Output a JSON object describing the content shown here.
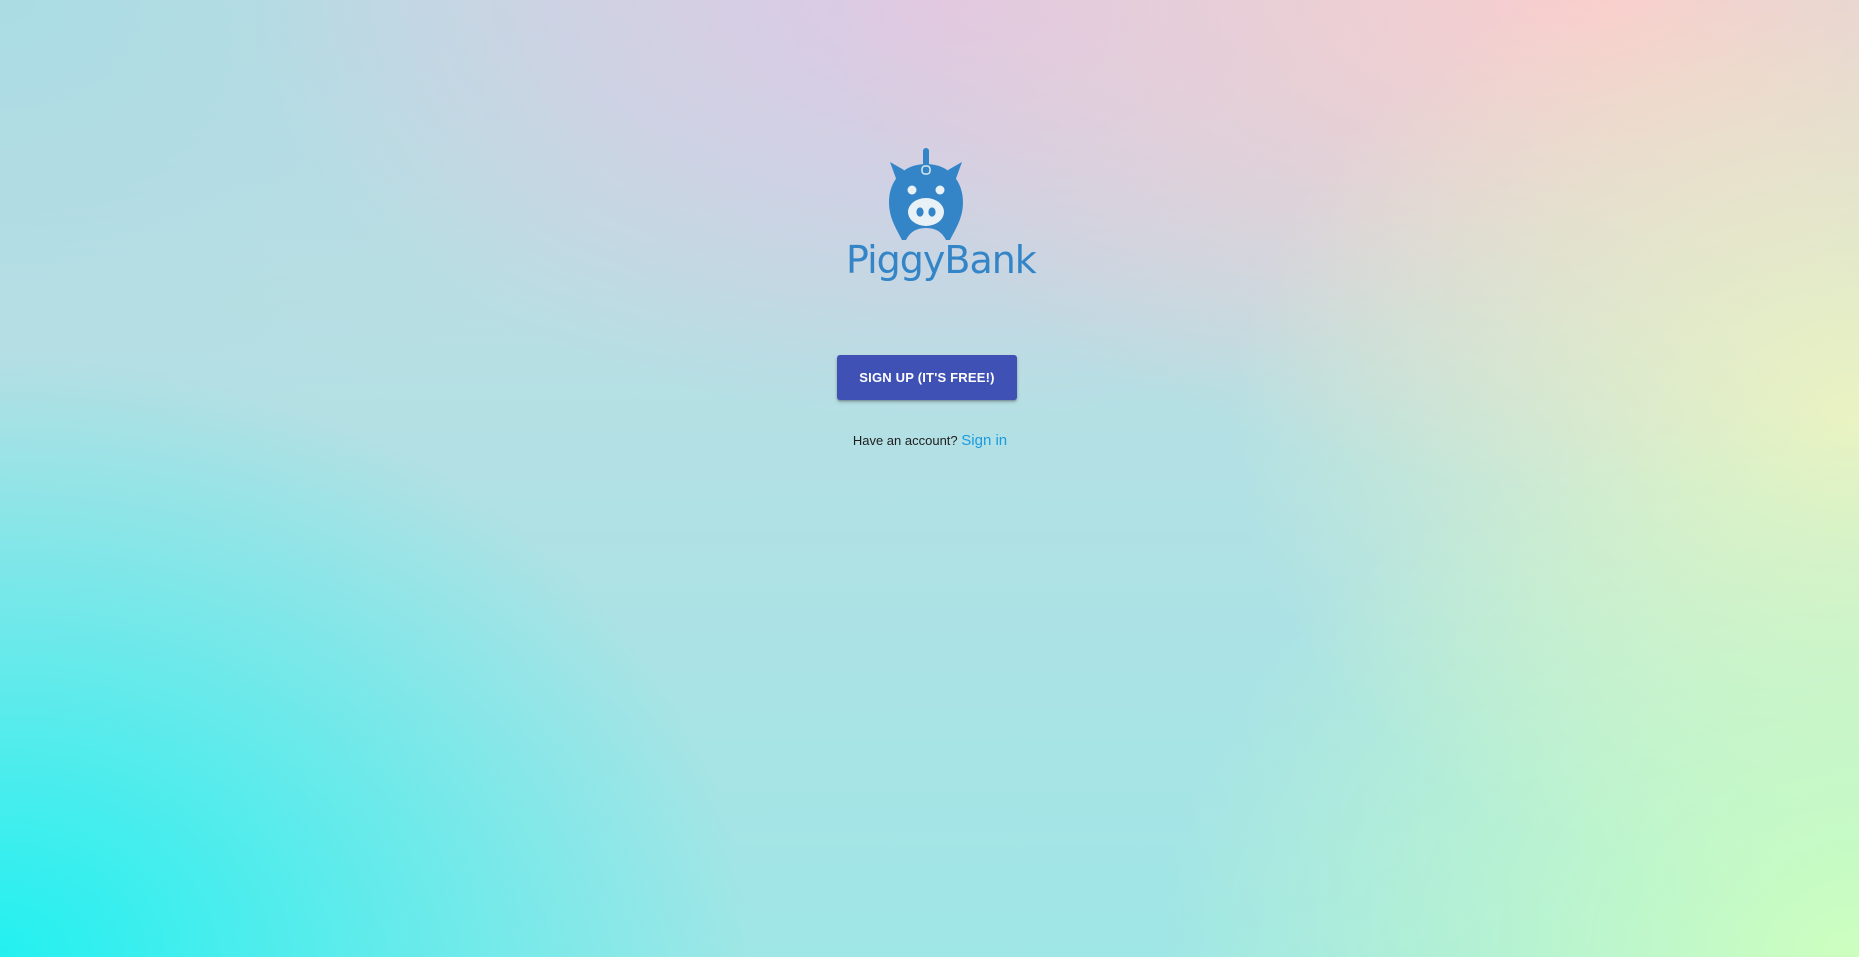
{
  "brand": {
    "name": "PiggyBank",
    "color": "#3485c8",
    "logo_icon": "piggy-bank-icon"
  },
  "signup": {
    "button_label": "SIGN UP (IT'S FREE!)",
    "button_color": "#3f51b5"
  },
  "signin": {
    "prompt": "Have an account?",
    "link_label": "Sign in",
    "link_color": "#1a9be0"
  }
}
